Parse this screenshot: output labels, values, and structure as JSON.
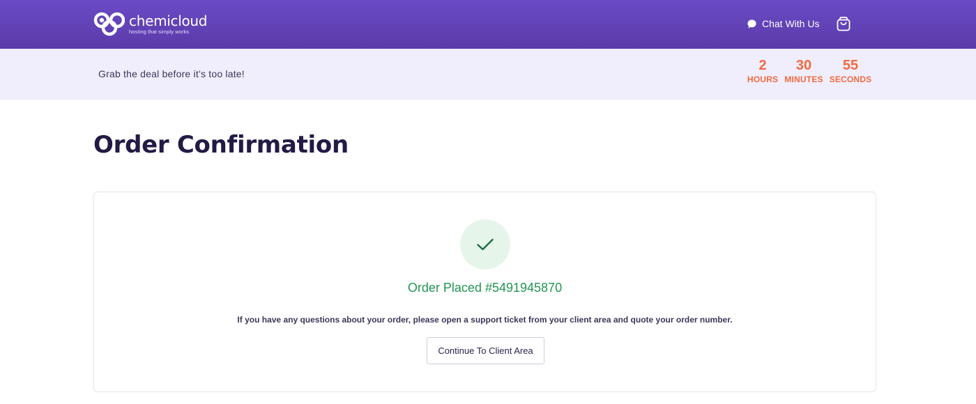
{
  "header": {
    "logo_name": "chemicloud",
    "logo_tagline": "hosting that simply works",
    "logo_icon": "chemicloud-logo-icon",
    "chat_label": "Chat With Us",
    "chat_icon": "chat-bubble-icon",
    "cart_icon": "shopping-bag-icon"
  },
  "promo": {
    "text": "Grab the deal before it’s too late!",
    "countdown": {
      "hours": "2",
      "hours_label": "HOURS",
      "minutes": "30",
      "minutes_label": "MINUTES",
      "seconds": "55",
      "seconds_label": "SECONDS"
    }
  },
  "main": {
    "title": "Order Confirmation",
    "status_icon": "checkmark-icon",
    "order_placed": "Order Placed #5491945870",
    "note": "If you have any questions about your order, please open a support ticket from your client area and quote your order number.",
    "continue_label": "Continue To Client Area"
  },
  "colors": {
    "header_purple": "#6a4bc6",
    "promo_bg": "#f0edfd",
    "countdown_orange": "#f06b3d",
    "success_green": "#219653",
    "title_navy": "#231a45"
  }
}
